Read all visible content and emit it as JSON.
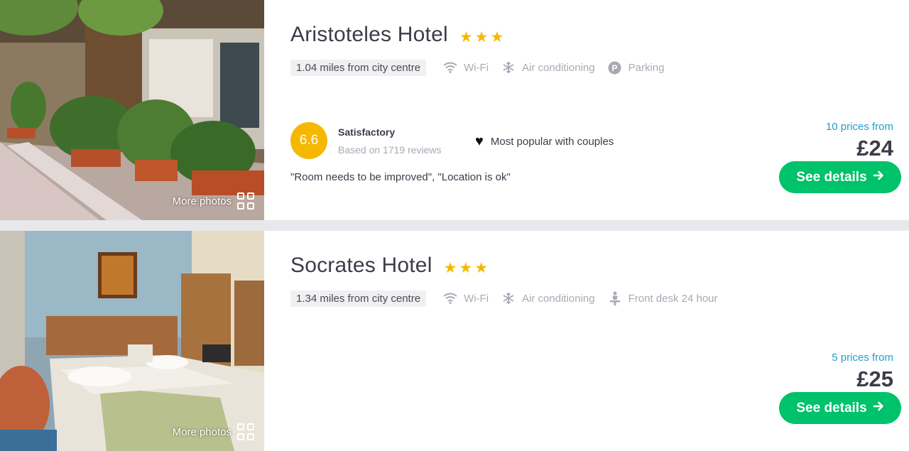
{
  "hotels": [
    {
      "name": "Aristoteles Hotel",
      "stars": 3,
      "distance": "1.04 miles from city centre",
      "amenities": [
        {
          "label": "Wi-Fi",
          "icon": "wifi-icon"
        },
        {
          "label": "Air conditioning",
          "icon": "snowflake-icon"
        },
        {
          "label": "Parking",
          "icon": "parking-icon"
        }
      ],
      "score": "6.6",
      "rating_label": "Satisfactory",
      "review_count": "Based on 1719 reviews",
      "popular": "Most popular with couples",
      "quote": "\"Room needs to be improved\", \"Location is ok\"",
      "prices_from": "10 prices from",
      "price": "£24",
      "cta": "See details",
      "more_photos": "More photos"
    },
    {
      "name": "Socrates Hotel",
      "stars": 3,
      "distance": "1.34 miles from city centre",
      "amenities": [
        {
          "label": "Wi-Fi",
          "icon": "wifi-icon"
        },
        {
          "label": "Air conditioning",
          "icon": "snowflake-icon"
        },
        {
          "label": "Front desk 24 hour",
          "icon": "receptionist-icon"
        }
      ],
      "prices_from": "5 prices from",
      "price": "£25",
      "cta": "See details",
      "more_photos": "More photos"
    }
  ],
  "colors": {
    "star": "#f5b800",
    "score_badge": "#f5b800",
    "cta": "#00c26a",
    "link": "#1f9ed1"
  }
}
